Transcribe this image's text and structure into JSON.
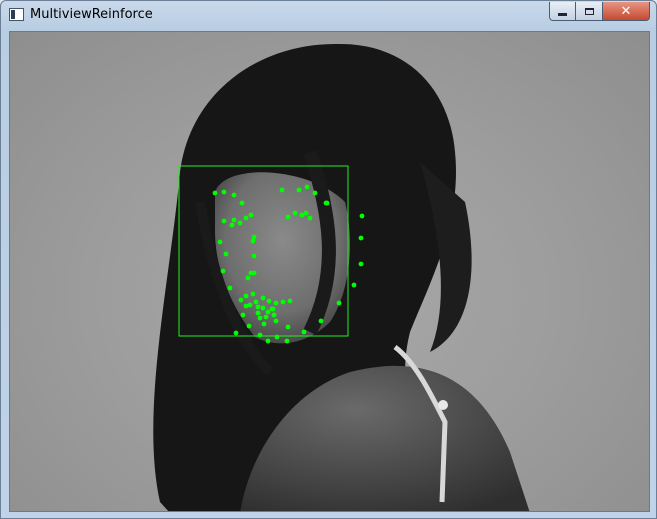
{
  "window": {
    "title": "MultiviewReinforce",
    "controls": {
      "minimize": "minimize",
      "maximize": "maximize",
      "close": "✕"
    }
  },
  "photo": {
    "description_icon": "grayscale-portrait-photo"
  },
  "colors": {
    "landmark": "#00ff00",
    "face_box": "#22ee22"
  },
  "landmarks_count": 68
}
